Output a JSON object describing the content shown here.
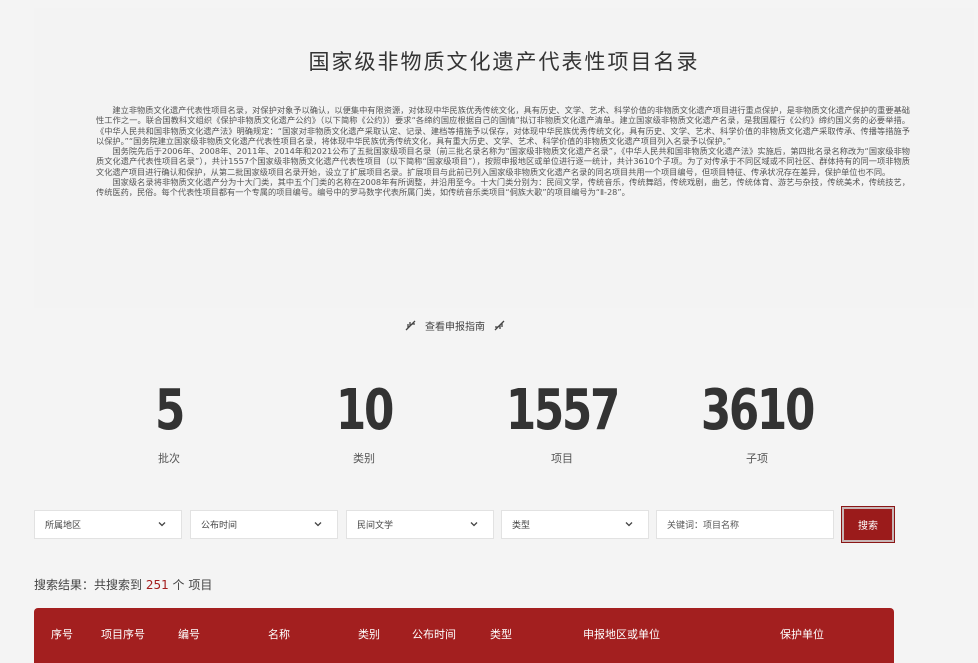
{
  "title": "国家级非物质文化遗产代表性项目名录",
  "intro": [
    "建立非物质文化遗产代表性项目名录，对保护对象予以确认，以便集中有限资源，对体现中华民族优秀传统文化，具有历史、文学、艺术、科学价值的非物质文化遗产项目进行重点保护，是非物质文化遗产保护的重要基础性工作之一。联合国教科文组织《保护非物质文化遗产公约》（以下简称《公约》）要求“各缔约国应根据自己的国情”拟订非物质文化遗产清单。建立国家级非物质文化遗产名录，是我国履行《公约》缔约国义务的必要举措。《中华人民共和国非物质文化遗产法》明确规定：“国家对非物质文化遗产采取认定、记录、建档等措施予以保存，对体现中华民族优秀传统文化，具有历史、文学、艺术、科学价值的非物质文化遗产采取传承、传播等措施予以保护。”“国务院建立国家级非物质文化遗产代表性项目名录，将体现中华民族优秀传统文化，具有重大历史、文学、艺术、科学价值的非物质文化遗产项目列入名录予以保护。”",
    "国务院先后于2006年、2008年、2011年、2014年和2021公布了五批国家级项目名录（前三批名录名称为“国家级非物质文化遗产名录”，《中华人民共和国非物质文化遗产法》实施后，第四批名录名称改为“国家级非物质文化遗产代表性项目名录”），共计1557个国家级非物质文化遗产代表性项目（以下简称“国家级项目”），按照申报地区或单位进行逐一统计，共计3610个子项。为了对传承于不同区域或不同社区、群体持有的同一项非物质文化遗产项目进行确认和保护，从第二批国家级项目名录开始，设立了扩展项目名录。扩展项目与此前已列入国家级非物质文化遗产名录的同名项目共用一个项目编号，但项目特征、传承状况存在差异，保护单位也不同。",
    "国家级名录将非物质文化遗产分为十大门类，其中五个门类的名称在2008年有所调整，并沿用至今。十大门类分别为：民间文学，传统音乐，传统舞蹈，传统戏剧，曲艺，传统体育、游艺与杂技，传统美术，传统技艺，传统医药，民俗。每个代表性项目都有一个专属的项目编号。编号中的罗马数字代表所属门类，如传统音乐类项目“侗族大歌”的项目编号为“Ⅱ-28”。"
  ],
  "guide": {
    "label": "查看申报指南"
  },
  "stats": [
    {
      "value": "5",
      "label": "批次"
    },
    {
      "value": "10",
      "label": "类别"
    },
    {
      "value": "1557",
      "label": "项目"
    },
    {
      "value": "3610",
      "label": "子项"
    }
  ],
  "filters": {
    "region": "所属地区",
    "time": "公布时间",
    "category": "民间文学",
    "type": "类型",
    "keyword_placeholder": "关键词：项目名称",
    "search_button": "搜索"
  },
  "result": {
    "prefix": "搜索结果：共搜索到 ",
    "count": "251",
    "suffix": " 个 项目"
  },
  "table": {
    "columns": [
      "序号",
      "项目序号",
      "编号",
      "名称",
      "类别",
      "公布时间",
      "类型",
      "申报地区或单位",
      "保护单位"
    ]
  },
  "colors": {
    "accent": "#a31f1f",
    "background": "#f4f4f4"
  }
}
